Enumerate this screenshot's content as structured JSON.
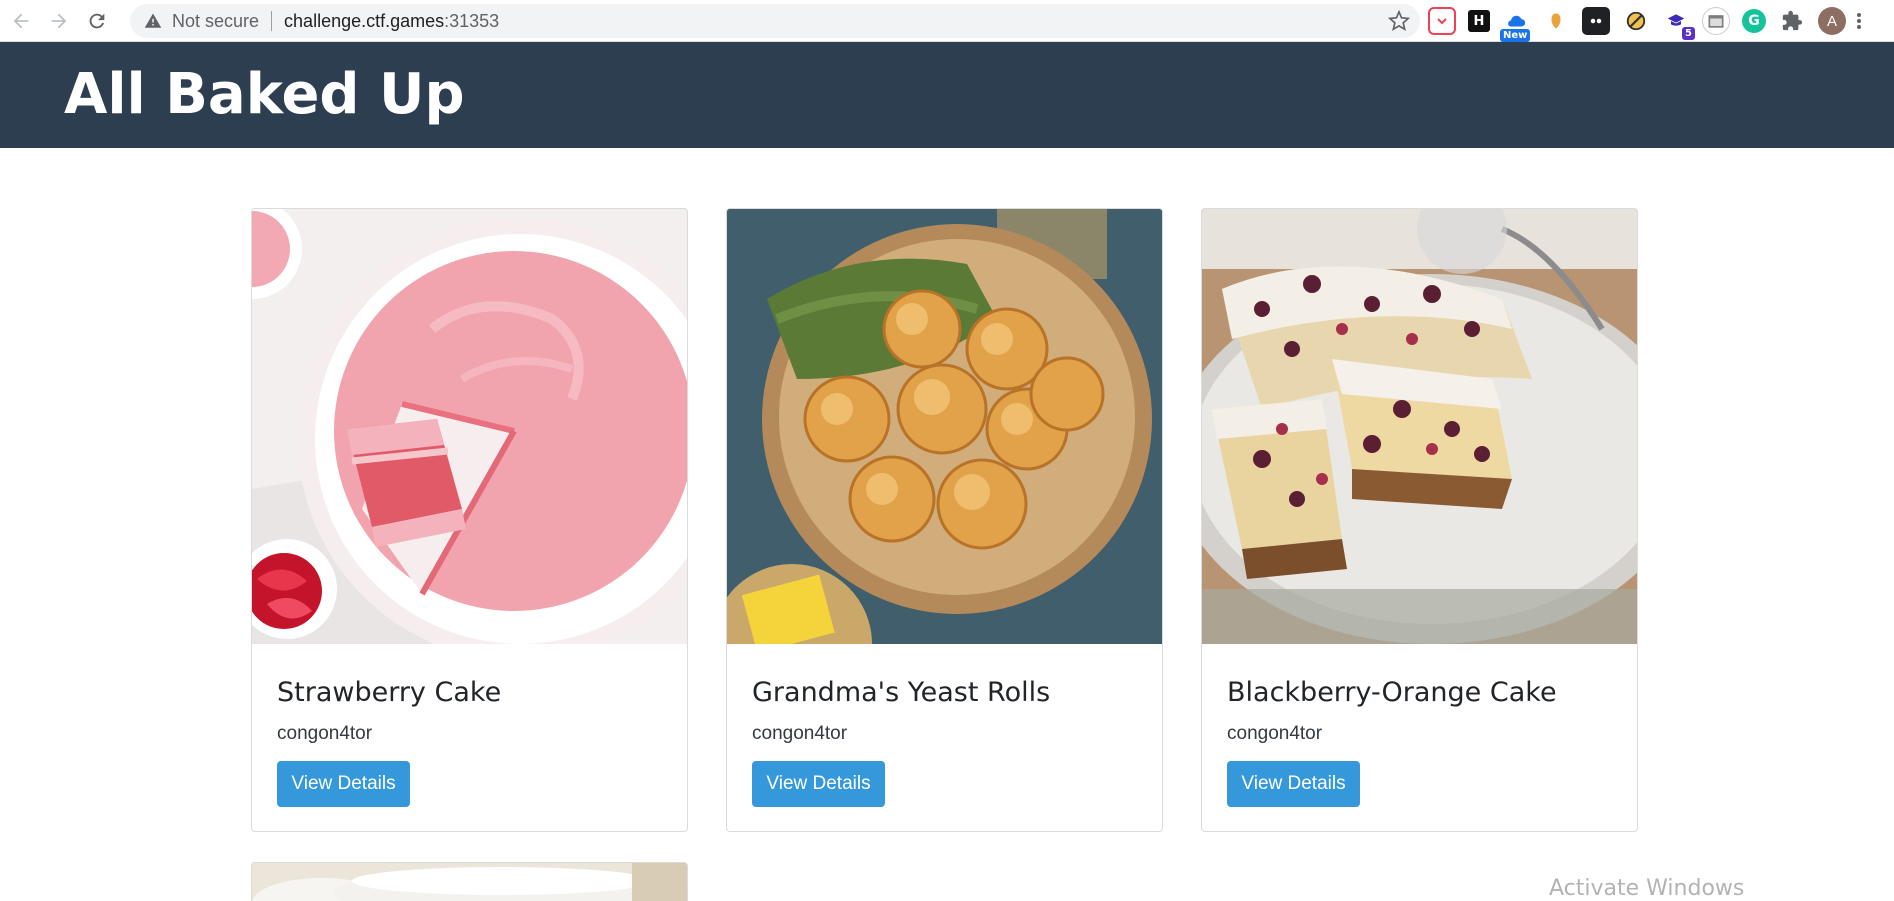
{
  "browser": {
    "security_label": "Not secure",
    "url_host": "challenge.ctf.games",
    "url_port": ":31353",
    "extensions": [
      {
        "name": "pocket-icon",
        "color": "#ef4056"
      },
      {
        "name": "hackerone-icon",
        "label": "H",
        "color": "#111111"
      },
      {
        "name": "cloud-icon",
        "badge": "New",
        "color": "#1a73e8"
      },
      {
        "name": "shield-icon",
        "color": "#e8a33d"
      },
      {
        "name": "theme-icon",
        "color": "#202124"
      },
      {
        "name": "block-icon",
        "color": "#c58b1a"
      },
      {
        "name": "badge-icon",
        "badge": "5",
        "color": "#5b2fc9"
      },
      {
        "name": "calendar-icon",
        "color": "#7d7d7d"
      },
      {
        "name": "grammarly-icon",
        "color": "#15c39a"
      },
      {
        "name": "puzzle-icon",
        "color": "#5f6368"
      }
    ],
    "profile_initial": "A"
  },
  "site": {
    "title": "All Baked Up",
    "header_color": "#2c3e50",
    "accent_color": "#3498db"
  },
  "recipes": [
    {
      "title": "Strawberry Cake",
      "author": "congon4tor",
      "button": "View Details"
    },
    {
      "title": "Grandma's Yeast Rolls",
      "author": "congon4tor",
      "button": "View Details"
    },
    {
      "title": "Blackberry-Orange Cake",
      "author": "congon4tor",
      "button": "View Details"
    }
  ],
  "overlay": {
    "watermark": "Activate Windows"
  }
}
